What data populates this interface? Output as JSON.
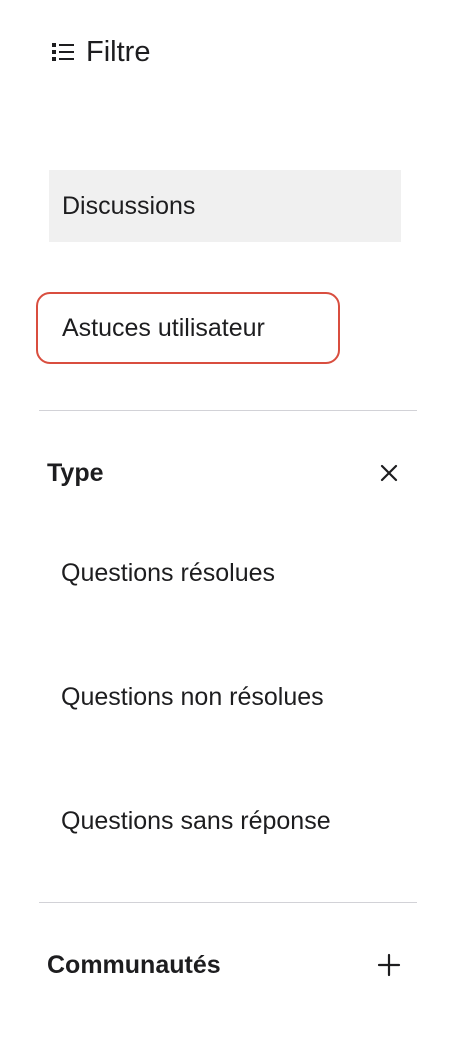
{
  "filter": {
    "title": "Filtre",
    "icon": "list-filter-icon"
  },
  "views": [
    {
      "label": "Discussions",
      "selected": true,
      "focused": false
    },
    {
      "label": "Astuces utilisateur",
      "selected": false,
      "focused": true
    }
  ],
  "sections": {
    "type": {
      "title": "Type",
      "toggle_icon": "close-icon",
      "expanded": true,
      "options": [
        {
          "label": "Questions résolues"
        },
        {
          "label": "Questions non résolues"
        },
        {
          "label": "Questions sans réponse"
        }
      ]
    },
    "communities": {
      "title": "Communautés",
      "toggle_icon": "plus-icon",
      "expanded": false
    }
  },
  "colors": {
    "text": "#1d1d1f",
    "selected_background": "#f0f0f0",
    "focus_ring": "#d94e3f",
    "divider": "#d2d2d7"
  }
}
